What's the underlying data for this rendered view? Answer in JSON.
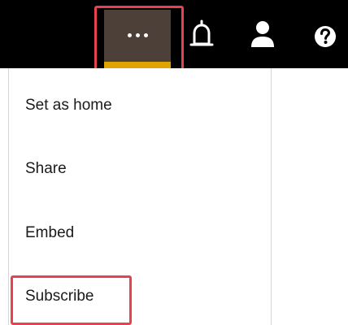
{
  "toolbar": {
    "more_icon": "more-horizontal-icon",
    "icons": [
      "bell-icon",
      "user-icon",
      "help-icon"
    ]
  },
  "menu": {
    "items": [
      {
        "label": "Set as home"
      },
      {
        "label": "Share"
      },
      {
        "label": "Embed"
      },
      {
        "label": "Subscribe"
      }
    ]
  },
  "colors": {
    "topbar": "#000000",
    "more_button_bg": "#4c4039",
    "active_indicator": "#e0a400",
    "highlight": "#e8414f",
    "menu_border": "#d6d6d6"
  }
}
